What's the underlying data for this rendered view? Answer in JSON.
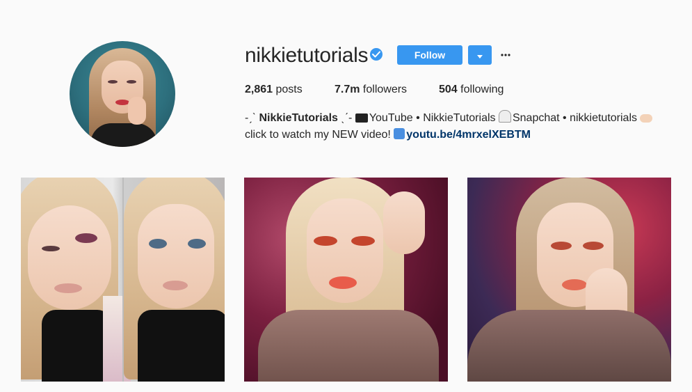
{
  "profile": {
    "username": "nikkietutorials",
    "verified": true,
    "follow_label": "Follow",
    "more_label": "···"
  },
  "stats": {
    "posts_count": "2,861",
    "posts_label": "posts",
    "followers_count": "7.7m",
    "followers_label": "followers",
    "following_count": "504",
    "following_label": "following"
  },
  "bio": {
    "prefix": "-ˏˋ ",
    "name": "NikkieTutorials",
    "suffix_name": " ˎˊ- ",
    "youtube_label": "YouTube • NikkieTutorials ",
    "snapchat_label": "Snapchat • nikkietutorials ",
    "line2": "click to watch my NEW video! ",
    "link": "youtu.be/4mrxelXEBTM"
  },
  "colors": {
    "accent": "#3897f0",
    "link": "#003569",
    "text": "#262626",
    "background": "#fafafa"
  },
  "icons": {
    "verified": "verified-badge-icon",
    "dropdown": "caret-down-icon",
    "more": "more-horizontal-icon",
    "youtube": "movie-camera-icon",
    "snapchat": "ghost-icon",
    "pointer": "pointing-hand-icon",
    "link": "arrow-emoji-icon"
  },
  "posts": [
    {
      "kind": "photo"
    },
    {
      "kind": "photo"
    },
    {
      "kind": "photo"
    }
  ]
}
